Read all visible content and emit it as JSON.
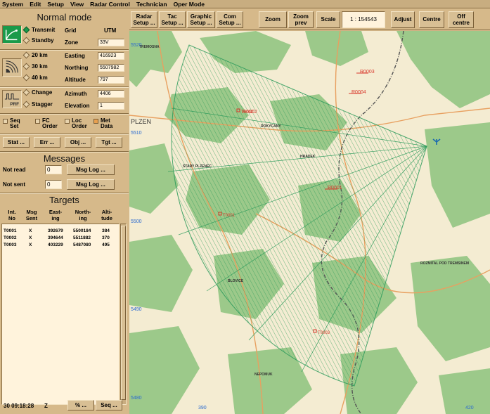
{
  "menu": [
    "System",
    "Edit",
    "Setup",
    "View",
    "Radar Control",
    "Technician",
    "Oper Mode"
  ],
  "mode_title": "Normal mode",
  "transmission": {
    "options": [
      "Transmit",
      "Standby"
    ],
    "selected": "Transmit"
  },
  "range": {
    "options": [
      "20 km",
      "30 km",
      "40 km"
    ],
    "selected": "30 km"
  },
  "frequency": {
    "icon_label": "PRF",
    "options": [
      "Change",
      "Stagger"
    ],
    "selected": ""
  },
  "position": {
    "grid_label": "Grid",
    "grid_value": "UTM",
    "zone_label": "Zone",
    "zone_value": "33V",
    "easting_label": "Easting",
    "easting_value": "416923",
    "northing_label": "Northing",
    "northing_value": "5507982",
    "altitude_label": "Altitude",
    "altitude_value": "797",
    "azimuth_label": "Azimuth",
    "azimuth_value": "4406",
    "elevation_label": "Elevation",
    "elevation_value": "1"
  },
  "checkboxes": [
    {
      "line1": "Seq",
      "line2": "Set",
      "checked": false
    },
    {
      "line1": "FC",
      "line2": "Order",
      "checked": false
    },
    {
      "line1": "Loc",
      "line2": "Order",
      "checked": false
    },
    {
      "line1": "Met",
      "line2": "Data",
      "checked": true
    }
  ],
  "action_buttons": [
    "Stat ...",
    "Err ...",
    "Obj ...",
    "Tgt ..."
  ],
  "messages": {
    "title": "Messages",
    "not_read_label": "Not read",
    "not_read_count": "0",
    "not_sent_label": "Not sent",
    "not_sent_count": "0",
    "log_button": "Msg Log ..."
  },
  "targets": {
    "title": "Targets",
    "headers": [
      {
        "line1": "Int.",
        "line2": "No"
      },
      {
        "line1": "Msg",
        "line2": "Sent"
      },
      {
        "line1": "East-",
        "line2": "ing"
      },
      {
        "line1": "North-",
        "line2": "ing"
      },
      {
        "line1": "Alti-",
        "line2": "tude"
      }
    ],
    "rows": [
      {
        "id": "T0001",
        "sent": "X",
        "easting": "392679",
        "northing": "5500184",
        "altitude": "384"
      },
      {
        "id": "T0002",
        "sent": "X",
        "easting": "394644",
        "northing": "5511882",
        "altitude": "370"
      },
      {
        "id": "T0003",
        "sent": "X",
        "easting": "403229",
        "northing": "5487080",
        "altitude": "495"
      }
    ]
  },
  "status": {
    "time": "30 09:18:28",
    "zone": "Z",
    "percent_button": "% ...",
    "seq_button": "Seq ..."
  },
  "toolbar": {
    "radar_setup": [
      "Radar",
      "Setup ..."
    ],
    "tac_setup": [
      "Tac",
      "Setup ..."
    ],
    "graphic_setup": [
      "Graphic",
      "Setup ..."
    ],
    "com_setup": [
      "Com",
      "Setup ..."
    ],
    "zoom": "Zoom",
    "zoom_prev": [
      "Zoom",
      "prev"
    ],
    "scale_label": "Scale",
    "scale_value": "1 : 154543",
    "adjust": "Adjust",
    "centre": "Centre",
    "off_centre": [
      "Off",
      "centre"
    ]
  },
  "map": {
    "towns": [
      "TREMOSNA",
      "PLZEN",
      "ROKYCANY",
      "HRADEK",
      "STARY PLZENEC",
      "BLOVICE",
      "ROZMITAL POD TREMSINEM",
      "NEPOMUK"
    ],
    "grid_labels": [
      "5520",
      "5510",
      "5500",
      "5490",
      "5480",
      "390",
      "420"
    ],
    "targets": [
      "T0001",
      "T0002",
      "T0003"
    ],
    "reference_points": [
      "R0001",
      "R0002",
      "R0003",
      "R0004"
    ],
    "colors": {
      "coverage": "#2a9a5a",
      "forest": "#9cc98a",
      "background": "#f4ecd2",
      "target": "#d8362a"
    }
  }
}
